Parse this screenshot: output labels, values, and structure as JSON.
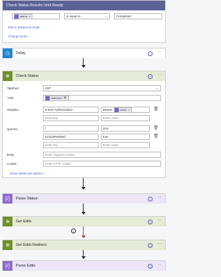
{
  "condition": {
    "token_label": "status",
    "operator": "is equal to",
    "value": "Completed",
    "edit_advanced": "Edit in advanced mode",
    "change_limits": "Change limits"
  },
  "delay": {
    "title": "Delay"
  },
  "check_status": {
    "title": "Check Status",
    "method_label": "Method",
    "method_value": "GET",
    "uri_label": "URI",
    "uri_token": "statusUrl",
    "headers_label": "Headers",
    "headers": [
      {
        "key": "X-Esri-Authorization",
        "value_prefix": "Bearer",
        "value_token": "token"
      }
    ],
    "header_key_placeholder": "Enter key",
    "header_value_placeholder": "Enter value",
    "queries_label": "Queries",
    "queries": [
      {
        "key": "f",
        "value": "json"
      },
      {
        "key": "includeRelated",
        "value": "true"
      }
    ],
    "query_key_placeholder": "Enter key",
    "query_value_placeholder": "Enter value",
    "body_label": "Body",
    "body_placeholder": "Enter request content",
    "cookie_label": "Cookie",
    "cookie_placeholder": "Enter HTTP cookie",
    "show_advanced": "Show advanced options"
  },
  "parse_status": {
    "title": "Parse Status"
  },
  "get_edits": {
    "title": "Get Edits"
  },
  "get_edits_redirect": {
    "title": "Get Edits Redirect"
  },
  "parse_edits": {
    "title": "Parse Edits"
  },
  "colors": {
    "loop": "#5a6296",
    "delay": "#1f85d8",
    "http": "#6f8f2b",
    "parse": "#8b6bcf",
    "link": "#4a63c7"
  },
  "icons": {
    "delay": "clock-icon",
    "http": "globe-icon",
    "parse": "braces-icon",
    "help": "help-icon",
    "more": "ellipsis-icon",
    "info": "info-icon"
  }
}
